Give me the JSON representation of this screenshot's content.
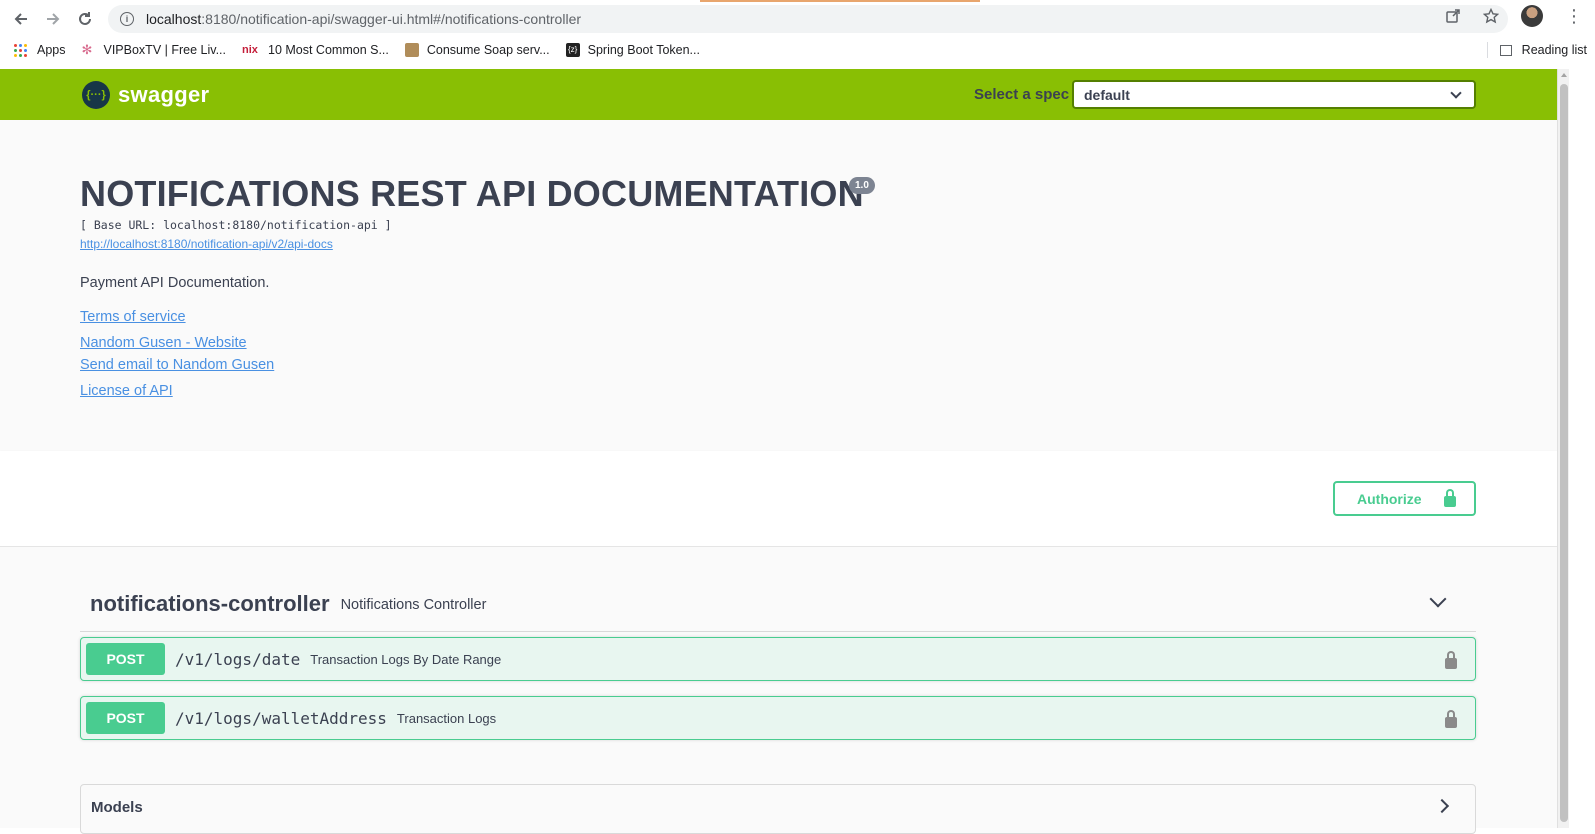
{
  "browser": {
    "url_host": "localhost",
    "url_path": ":8180/notification-api/swagger-ui.html#/notifications-controller",
    "bookmarks": [
      {
        "label": "Apps"
      },
      {
        "label": "VIPBoxTV | Free Liv..."
      },
      {
        "label": "10 Most Common S..."
      },
      {
        "label": "Consume Soap serv..."
      },
      {
        "label": "Spring Boot Token..."
      }
    ],
    "reading_list": "Reading list"
  },
  "topbar": {
    "logo_text": "swagger",
    "logo_mark": "{···}",
    "spec_label": "Select a spec",
    "spec_value": "default"
  },
  "info": {
    "title": "NOTIFICATIONS REST API DOCUMENTATION",
    "version": "1.0",
    "base_url": "[ Base URL: localhost:8180/notification-api ]",
    "docs_link": "http://localhost:8180/notification-api/v2/api-docs",
    "description": "Payment API Documentation.",
    "terms": "Terms of service",
    "website": "Nandom Gusen - Website",
    "email": "Send email to Nandom Gusen",
    "license": "License of API"
  },
  "auth": {
    "button_label": "Authorize"
  },
  "tag": {
    "name": "notifications-controller",
    "description": "Notifications Controller"
  },
  "operations": [
    {
      "method": "POST",
      "path": "/v1/logs/date",
      "summary": "Transaction Logs By Date Range"
    },
    {
      "method": "POST",
      "path": "/v1/logs/walletAddress",
      "summary": "Transaction Logs"
    }
  ],
  "models": {
    "title": "Models"
  },
  "colors": {
    "topbar": "#89bf04",
    "post": "#49cc90",
    "link": "#4990e2",
    "text": "#3b4151"
  }
}
